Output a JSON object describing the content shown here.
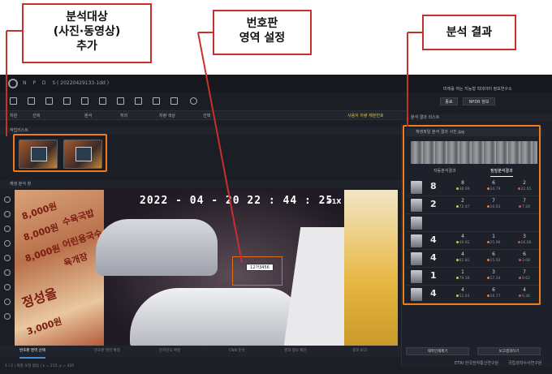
{
  "app": {
    "name": "N P D S",
    "document": "( 20220429133-1dd )",
    "right_info": "미래를 여는 지능형 빅데이터 정보연구소",
    "buttons": [
      "종료",
      "NPDR 정보"
    ]
  },
  "filter_bar": [
    "차원",
    "선택",
    "분석",
    "처리",
    "차량 색상",
    "선택",
    "사용자 차량 재분번호"
  ],
  "panels": {
    "file_list": "작업리스트",
    "video_view": "재생 분석 창",
    "result_panel": "분석 결과 리스트"
  },
  "video": {
    "timestamp": "2022 - 04 - 20 22 : 44 : 25",
    "speed": "+1X",
    "plate_text": "12가3456",
    "sign_left": [
      "8,000원",
      "수육국밥",
      "8,000원",
      "어린용국수",
      "8,000원",
      "육개장",
      "정성을",
      "3,000원"
    ]
  },
  "steps": [
    "번호판 영역 선택",
    "번호판 영역 확정",
    "문자인식 확정",
    "CNN 분석",
    "결과 정보 확인",
    "결과 보고"
  ],
  "status_text": "1 / 2   |   화질 보정 없음   |   x = 215, y = 425",
  "result": {
    "file_title": "재생파일 분석 결과 사진.jpg",
    "tabs": [
      "자동분석결과",
      "정밀분석결과"
    ],
    "rows": [
      {
        "big": "8",
        "cells": [
          [
            "8",
            "38.09"
          ],
          [
            "6",
            "34.79"
          ],
          [
            "2",
            "22.65"
          ]
        ]
      },
      {
        "big": "2",
        "cells": [
          [
            "2",
            "72.47"
          ],
          [
            "7",
            "16.63"
          ],
          [
            "7",
            "7.28"
          ]
        ]
      },
      {
        "big": "",
        "cells": [
          [
            "",
            ""
          ],
          [
            "",
            ""
          ],
          [
            "",
            ""
          ]
        ]
      },
      {
        "big": "4",
        "cells": [
          [
            "4",
            "49.02"
          ],
          [
            "1",
            "25.96"
          ],
          [
            "3",
            "16.06"
          ]
        ]
      },
      {
        "big": "4",
        "cells": [
          [
            "4",
            "61.81"
          ],
          [
            "6",
            "15.02"
          ],
          [
            "6",
            "3.08"
          ]
        ]
      },
      {
        "big": "1",
        "cells": [
          [
            "1",
            "79.16"
          ],
          [
            "3",
            "17.34"
          ],
          [
            "7",
            "9.62"
          ]
        ]
      },
      {
        "big": "4",
        "cells": [
          [
            "4",
            "52.03"
          ],
          [
            "6",
            "18.77"
          ],
          [
            "4",
            "9.36"
          ]
        ]
      }
    ],
    "bottom_buttons": [
      "재학인재제기",
      "보고결과하기"
    ],
    "orgs": [
      "ETRI 한국전자통신연구원",
      "국립과학수사연구원"
    ]
  },
  "callouts": {
    "left": "분석대상\n(사진·동영상)\n추가",
    "middle": "번호판\n영역 설정",
    "right": "분석 결과"
  }
}
